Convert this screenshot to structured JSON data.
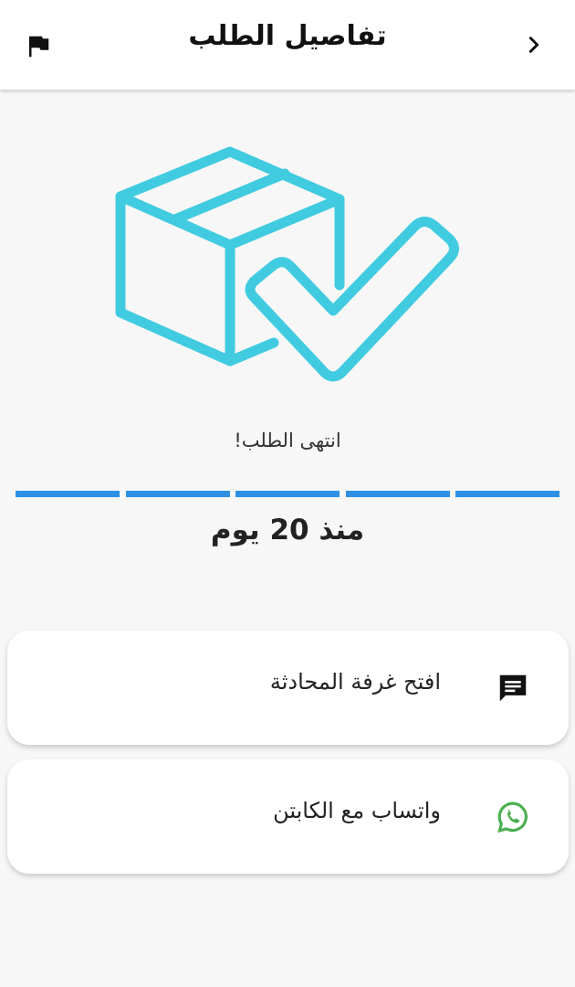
{
  "header": {
    "title": "تفاصيل الطلب",
    "back_icon": "chevron-right-icon",
    "report_icon": "flag-icon"
  },
  "hero": {
    "icon": "package-check-icon",
    "accent_color": "#40cbe0"
  },
  "status": {
    "message": "انتهى الطلب!",
    "progress_steps_total": 5,
    "progress_steps_completed": 5,
    "progress_color": "#2e90e5",
    "elapsed": "منذ 20 يوم"
  },
  "actions": [
    {
      "label": "افتح غرفة المحادثة",
      "icon": "chat-icon",
      "color": "#111111"
    },
    {
      "label": "واتساب مع الكابتن",
      "icon": "whatsapp-icon",
      "color": "#4caf50"
    }
  ]
}
